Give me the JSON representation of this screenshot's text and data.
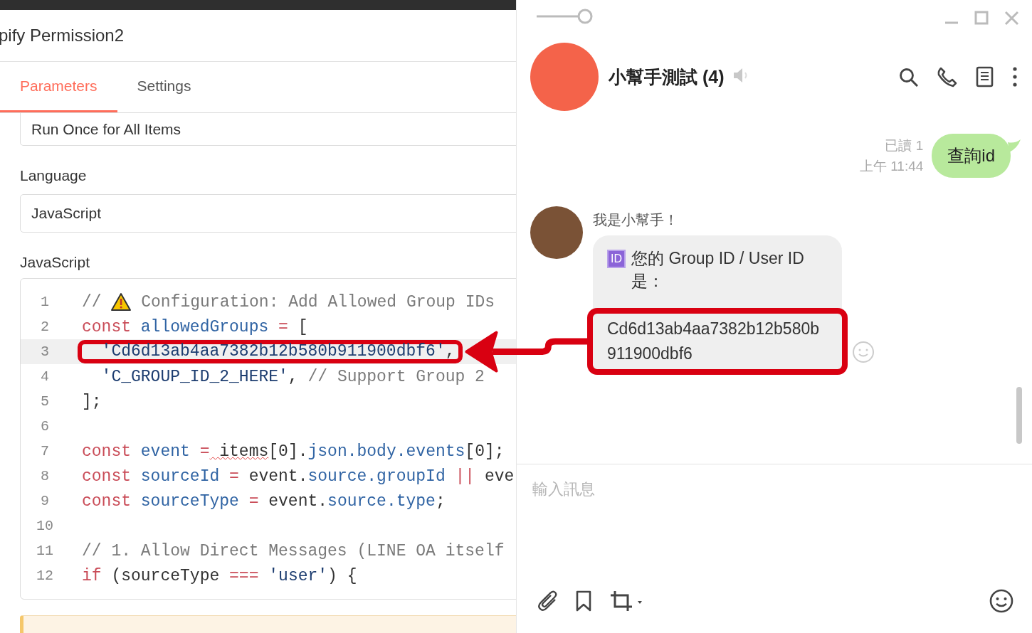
{
  "editor": {
    "title": "pify Permission2",
    "tabs": [
      {
        "label": "Parameters",
        "selected": true
      },
      {
        "label": "Settings",
        "selected": false
      }
    ],
    "mode_field": {
      "value": "Run Once for All Items"
    },
    "language": {
      "label": "Language",
      "value": "JavaScript"
    },
    "code": {
      "label": "JavaScript",
      "lines": [
        {
          "number": "1",
          "active": false,
          "tokens": [
            {
              "kind": "comment",
              "text": "// "
            },
            {
              "kind": "warning-icon"
            },
            {
              "kind": "comment",
              "text": " Configuration: Add Allowed Group IDs"
            }
          ]
        },
        {
          "number": "2",
          "active": false,
          "tokens": [
            {
              "kind": "keyword",
              "text": "const"
            },
            {
              "kind": "name",
              "text": " allowedGroups"
            },
            {
              "kind": "keyword",
              "text": " ="
            },
            {
              "kind": "plain",
              "text": " ["
            }
          ]
        },
        {
          "number": "3",
          "active": true,
          "tokens": [
            {
              "kind": "string",
              "text": "  'Cd6d13ab4aa7382b12b580b911900dbf6'"
            },
            {
              "kind": "plain",
              "text": ","
            }
          ]
        },
        {
          "number": "4",
          "active": false,
          "tokens": [
            {
              "kind": "string",
              "text": "  'C_GROUP_ID_2_HERE'"
            },
            {
              "kind": "plain",
              "text": ","
            },
            {
              "kind": "comment",
              "text": " // Support Group 2"
            }
          ]
        },
        {
          "number": "5",
          "active": false,
          "tokens": [
            {
              "kind": "plain",
              "text": "];"
            }
          ]
        },
        {
          "number": "6",
          "active": false
        },
        {
          "number": "7",
          "active": false,
          "tokens": [
            {
              "kind": "keyword",
              "text": "const"
            },
            {
              "kind": "name",
              "text": " event"
            },
            {
              "kind": "keyword",
              "text": " ="
            },
            {
              "kind": "flagged",
              "text": " items"
            },
            {
              "kind": "plain",
              "text": "[0]."
            },
            {
              "kind": "name",
              "text": "json.body.events"
            },
            {
              "kind": "plain",
              "text": "[0];"
            }
          ]
        },
        {
          "number": "8",
          "active": false,
          "tokens": [
            {
              "kind": "keyword",
              "text": "const"
            },
            {
              "kind": "name",
              "text": " sourceId"
            },
            {
              "kind": "keyword",
              "text": " ="
            },
            {
              "kind": "plain",
              "text": " event."
            },
            {
              "kind": "name",
              "text": "source.groupId"
            },
            {
              "kind": "keyword",
              "text": " ||"
            },
            {
              "kind": "plain",
              "text": " eve"
            }
          ]
        },
        {
          "number": "9",
          "active": false,
          "tokens": [
            {
              "kind": "keyword",
              "text": "const"
            },
            {
              "kind": "name",
              "text": " sourceType"
            },
            {
              "kind": "keyword",
              "text": " ="
            },
            {
              "kind": "plain",
              "text": " event."
            },
            {
              "kind": "name",
              "text": "source.type"
            },
            {
              "kind": "plain",
              "text": ";"
            }
          ]
        },
        {
          "number": "10",
          "active": false
        },
        {
          "number": "11",
          "active": false,
          "tokens": [
            {
              "kind": "comment",
              "text": "// 1. Allow Direct Messages (LINE OA itself"
            }
          ]
        },
        {
          "number": "12",
          "active": false,
          "tokens": [
            {
              "kind": "keyword",
              "text": "if"
            },
            {
              "kind": "plain",
              "text": " (sourceType"
            },
            {
              "kind": "keyword",
              "text": " ==="
            },
            {
              "kind": "string",
              "text": " 'user'"
            },
            {
              "kind": "plain",
              "text": ") {"
            }
          ]
        }
      ]
    }
  },
  "chat": {
    "title": "小幫手測試 (4)",
    "messages": [
      {
        "kind": "sent",
        "read": "已讀 1",
        "time": "上午 11:44",
        "text": "查詢id"
      },
      {
        "kind": "received",
        "sender": "我是小幫手！",
        "badge": "ID",
        "text": "您的 Group ID / User ID 是：",
        "id_text": "Cd6d13ab4aa7382b12b580b911900dbf6"
      }
    ],
    "input": {
      "placeholder": "輸入訊息"
    }
  }
}
